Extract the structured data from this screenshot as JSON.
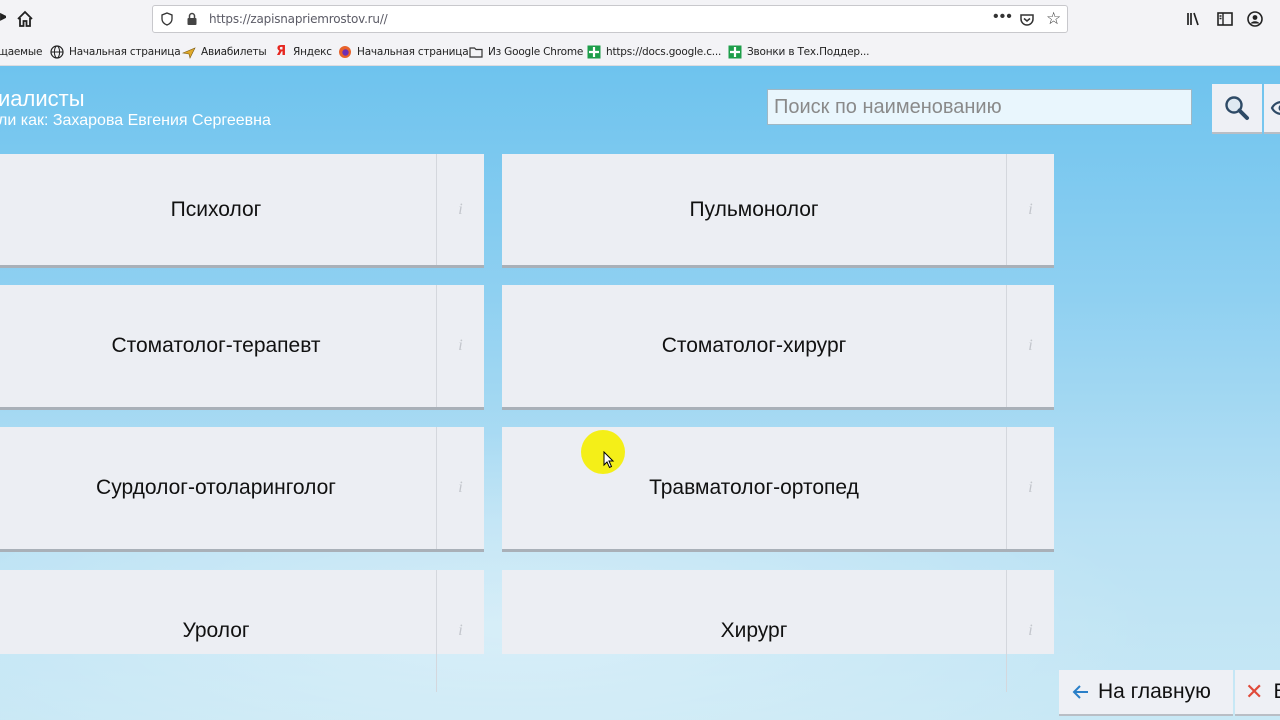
{
  "browser": {
    "url": "https://zapisnapriemrostov.ru//",
    "bookmarks": [
      {
        "label": "щаемые",
        "icon": "none"
      },
      {
        "label": "Начальная страница",
        "icon": "globe-icon"
      },
      {
        "label": "Авиабилеты",
        "icon": "plane-icon"
      },
      {
        "label": "Яндекс",
        "icon": "yandex-icon"
      },
      {
        "label": "Начальная страница",
        "icon": "firefox-icon"
      },
      {
        "label": "Из Google Chrome",
        "icon": "folder-icon"
      },
      {
        "label": "https://docs.google.c...",
        "icon": "sheets-icon"
      },
      {
        "label": "Звонки в Тех.Поддер...",
        "icon": "sheets-icon"
      }
    ]
  },
  "header": {
    "title": "иалисты",
    "subtitle": "ли как: Захарова Евгения Сергеевна",
    "search_placeholder": "Поиск по наименованию"
  },
  "specialists": [
    {
      "name": "Психолог",
      "info": "i"
    },
    {
      "name": "Пульмонолог",
      "info": "i"
    },
    {
      "name": "Стоматолог-терапевт",
      "info": "i"
    },
    {
      "name": "Стоматолог-хирург",
      "info": "i"
    },
    {
      "name": "Сурдолог-отоларинголог",
      "info": "i"
    },
    {
      "name": "Травматолог-ортопед",
      "info": "i"
    },
    {
      "name": "Уролог",
      "info": "i"
    },
    {
      "name": "Хирург",
      "info": "i"
    }
  ],
  "footer": {
    "home_label": "На главную",
    "exit_label": "В"
  },
  "colors": {
    "page_bg": "#8fd0f1",
    "card_bg": "#eceef3",
    "accent_blue": "#2a7fc8",
    "close_red": "#e04a3a"
  }
}
